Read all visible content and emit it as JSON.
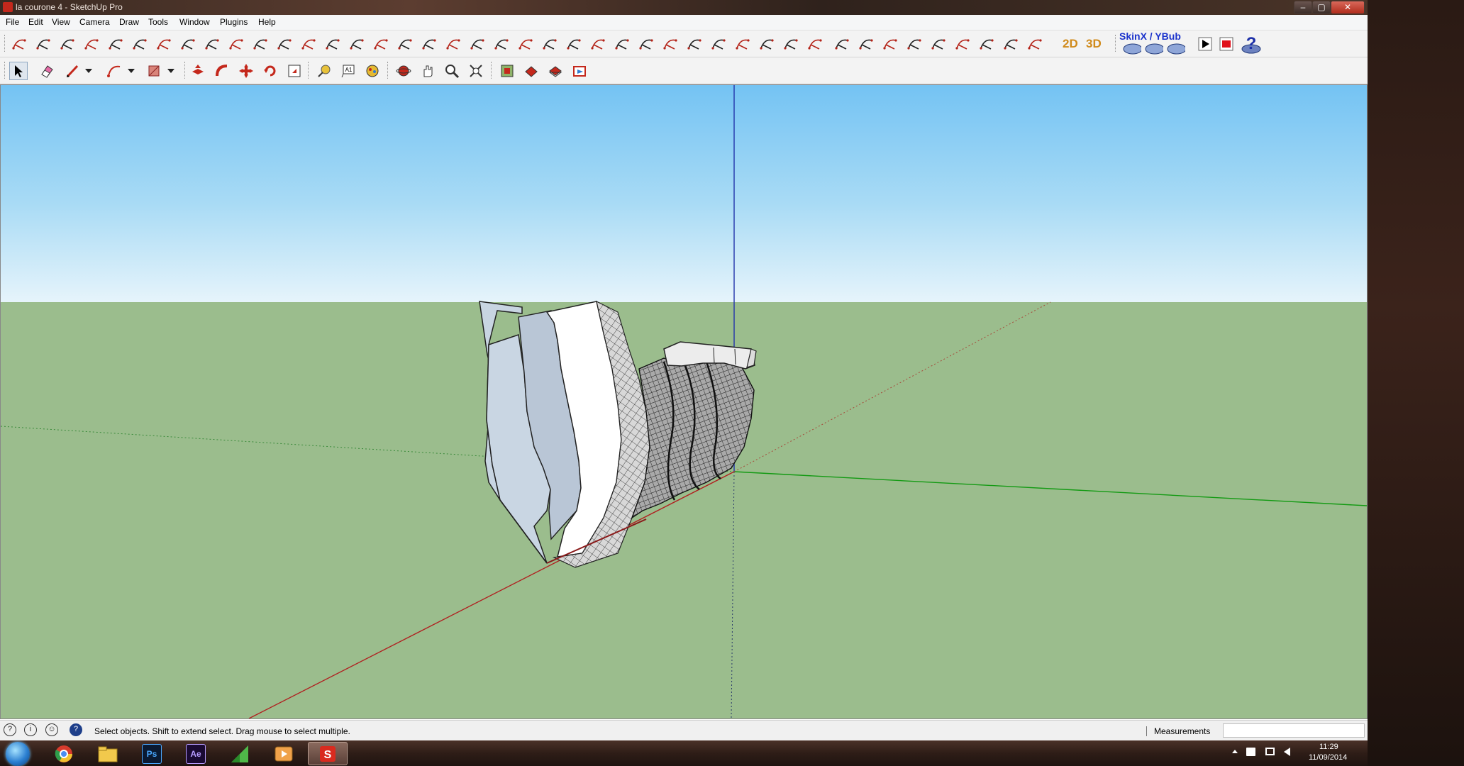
{
  "window": {
    "title": "la courone 4 - SketchUp Pro",
    "min_label": "–",
    "max_label": "▢",
    "close_label": "✕"
  },
  "menu": {
    "items": [
      "File",
      "Edit",
      "View",
      "Camera",
      "Draw",
      "Tools",
      "Window",
      "Plugins",
      "Help"
    ]
  },
  "toolbar": {
    "btn_2d": "2D",
    "btn_3d": "3D",
    "skinx_label": "SkinX / YBub"
  },
  "viewport": {
    "sky_color": "#74c3f3",
    "ground_color": "#9bbd8d"
  },
  "status": {
    "message": "Select objects. Shift to extend select. Drag mouse to select multiple.",
    "measurements_label": "Measurements",
    "measurements_value": ""
  },
  "taskbar": {
    "apps": [
      {
        "name": "chrome",
        "label": ""
      },
      {
        "name": "explorer",
        "label": ""
      },
      {
        "name": "photoshop",
        "label": "Ps"
      },
      {
        "name": "after-effects",
        "label": "Ae"
      },
      {
        "name": "camtasia",
        "label": ""
      },
      {
        "name": "media-player",
        "label": ""
      },
      {
        "name": "sketchup",
        "label": ""
      }
    ],
    "clock_time": "11:29",
    "clock_date": "11/09/2014"
  }
}
